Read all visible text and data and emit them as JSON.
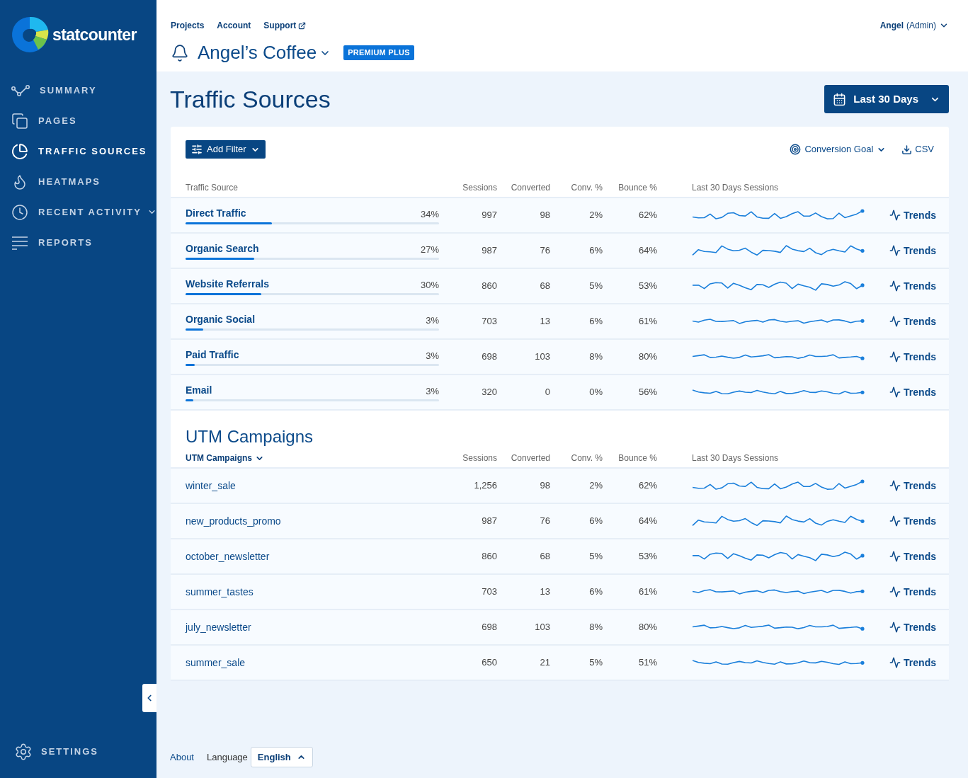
{
  "brand": {
    "name": "statcounter"
  },
  "sidebar": {
    "items": [
      {
        "label": "SUMMARY",
        "selected": false,
        "expandable": false
      },
      {
        "label": "PAGES",
        "selected": false,
        "expandable": false
      },
      {
        "label": "TRAFFIC SOURCES",
        "selected": true,
        "expandable": false
      },
      {
        "label": "HEATMAPS",
        "selected": false,
        "expandable": false
      },
      {
        "label": "RECENT ACTIVITY",
        "selected": false,
        "expandable": true
      },
      {
        "label": "REPORTS",
        "selected": false,
        "expandable": false
      }
    ],
    "settings": "SETTINGS"
  },
  "top_nav": {
    "links": [
      {
        "label": "Projects",
        "external": false
      },
      {
        "label": "Account",
        "external": false
      },
      {
        "label": "Support",
        "external": true
      }
    ],
    "user": {
      "name": "Angel",
      "role": "(Admin)"
    }
  },
  "project": {
    "name": "Angel’s Coffee",
    "badge": "PREMIUM PLUS"
  },
  "page_title": "Traffic Sources",
  "date_range": "Last 30 Days",
  "toolbar": {
    "add_filter": "Add Filter",
    "conversion_goal": "Conversion Goal",
    "csv": "CSV"
  },
  "sources_table": {
    "columns": [
      "Traffic Source",
      "Sessions",
      "Converted",
      "Conv. %",
      "Bounce %",
      "Last 30 Days Sessions"
    ],
    "rows": [
      {
        "name": "Direct Traffic",
        "share": "34%",
        "level": 0.34,
        "sessions": "997",
        "converted": "98",
        "conv": "2%",
        "bounce": "62%",
        "trends": "Trends"
      },
      {
        "name": "Organic Search",
        "share": "27%",
        "level": 0.27,
        "sessions": "987",
        "converted": "76",
        "conv": "6%",
        "bounce": "64%",
        "trends": "Trends"
      },
      {
        "name": "Website Referrals",
        "share": "30%",
        "level": 0.3,
        "sessions": "860",
        "converted": "68",
        "conv": "5%",
        "bounce": "53%",
        "trends": "Trends"
      },
      {
        "name": "Organic Social",
        "share": "3%",
        "level": 0.07,
        "sessions": "703",
        "converted": "13",
        "conv": "6%",
        "bounce": "61%",
        "trends": "Trends"
      },
      {
        "name": "Paid Traffic",
        "share": "3%",
        "level": 0.035,
        "sessions": "698",
        "converted": "103",
        "conv": "8%",
        "bounce": "80%",
        "trends": "Trends"
      },
      {
        "name": "Email",
        "share": "3%",
        "level": 0.03,
        "sessions": "320",
        "converted": "0",
        "conv": "0%",
        "bounce": "56%",
        "trends": "Trends"
      }
    ]
  },
  "utm": {
    "title": "UTM Campaigns",
    "columns": [
      "UTM Campaigns",
      "Sessions",
      "Converted",
      "Conv. %",
      "Bounce %",
      "Last 30 Days Sessions"
    ],
    "rows": [
      {
        "name": "winter_sale",
        "sessions": "1,256",
        "converted": "98",
        "conv": "2%",
        "bounce": "62%",
        "trends": "Trends"
      },
      {
        "name": "new_products_promo",
        "sessions": "987",
        "converted": "76",
        "conv": "6%",
        "bounce": "64%",
        "trends": "Trends"
      },
      {
        "name": "october_newsletter",
        "sessions": "860",
        "converted": "68",
        "conv": "5%",
        "bounce": "53%",
        "trends": "Trends"
      },
      {
        "name": "summer_tastes",
        "sessions": "703",
        "converted": "13",
        "conv": "6%",
        "bounce": "61%",
        "trends": "Trends"
      },
      {
        "name": "july_newsletter",
        "sessions": "698",
        "converted": "103",
        "conv": "8%",
        "bounce": "80%",
        "trends": "Trends"
      },
      {
        "name": "summer_sale",
        "sessions": "650",
        "converted": "21",
        "conv": "5%",
        "bounce": "51%",
        "trends": "Trends"
      }
    ]
  },
  "footer": {
    "about": "About",
    "language_label": "Language",
    "language": "English"
  }
}
